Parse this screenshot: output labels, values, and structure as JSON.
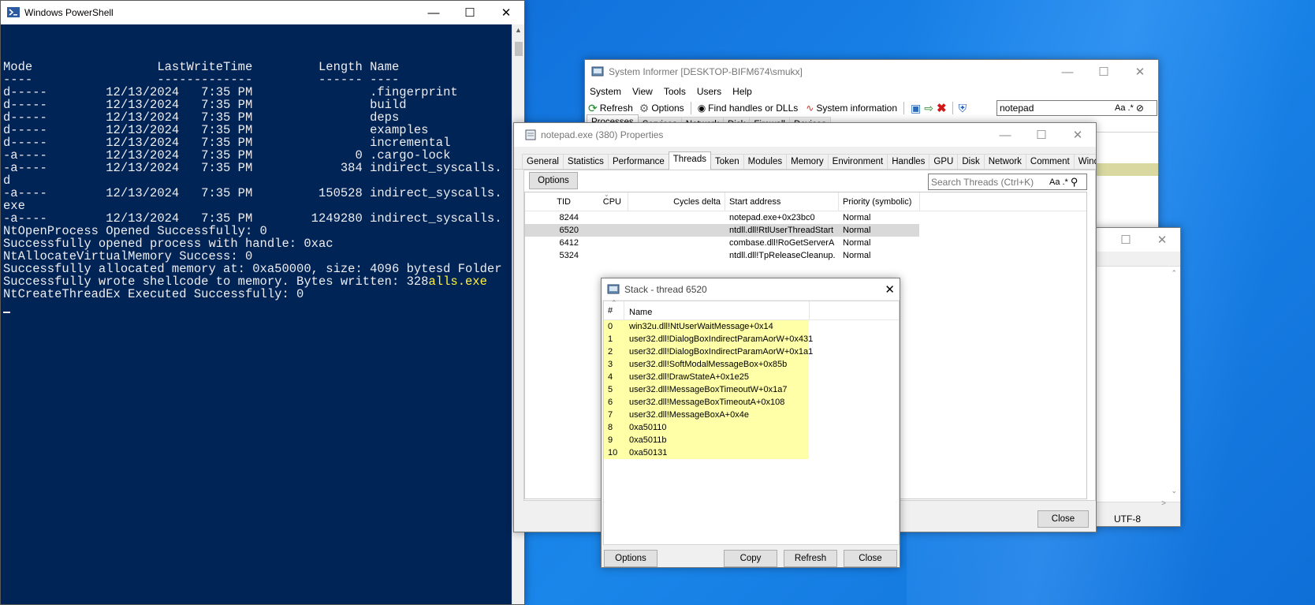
{
  "powershell": {
    "title": "Windows PowerShell",
    "lines": [
      "",
      "Mode                 LastWriteTime         Length Name",
      "----                 -------------         ------ ----",
      "d-----        12/13/2024   7:35 PM                .fingerprint",
      "d-----        12/13/2024   7:35 PM                build",
      "d-----        12/13/2024   7:35 PM                deps",
      "d-----        12/13/2024   7:35 PM                examples",
      "d-----        12/13/2024   7:35 PM                incremental",
      "-a----        12/13/2024   7:35 PM              0 .cargo-lock",
      "-a----        12/13/2024   7:35 PM            384 indirect_syscalls.",
      "d",
      "-a----        12/13/2024   7:35 PM         150528 indirect_syscalls.",
      "exe",
      "-a----        12/13/2024   7:35 PM        1249280 indirect_syscalls.",
      "NtOpenProcess Opened Successfully: 0",
      "Successfully opened process with handle: 0xac",
      "NtAllocateVirtualMemory Success: 0",
      "Successfully allocated memory at: 0xa50000, size: 4096 bytesd Folder",
      "Successfully wrote shellcode to memory. Bytes written: 328",
      "NtCreateThreadEx Executed Successfully: 0"
    ],
    "line_19_suffix": "alls.exe"
  },
  "system_informer": {
    "title": "System Informer [DESKTOP-BIFM674\\smukx]",
    "menu": [
      "System",
      "View",
      "Tools",
      "Users",
      "Help"
    ],
    "toolbar": {
      "refresh": "Refresh",
      "options": "Options",
      "find_handles": "Find handles or DLLs",
      "system_info": "System information",
      "search_value": "notepad"
    },
    "tabs": [
      "Processes",
      "Services",
      "Network",
      "Disk",
      "Firewall",
      "Devices"
    ]
  },
  "properties": {
    "title": "notepad.exe (380) Properties",
    "tabs": [
      "General",
      "Statistics",
      "Performance",
      "Threads",
      "Token",
      "Modules",
      "Memory",
      "Environment",
      "Handles",
      "GPU",
      "Disk",
      "Network",
      "Comment",
      "Windows"
    ],
    "options_label": "Options",
    "search_placeholder": "Search Threads (Ctrl+K)",
    "columns": [
      "TID",
      "CPU",
      "Cycles delta",
      "Start address",
      "Priority (symbolic)"
    ],
    "rows": [
      {
        "tid": "8244",
        "start": "notepad.exe+0x23bc0",
        "priority": "Normal"
      },
      {
        "tid": "6520",
        "start": "ntdll.dll!RtlUserThreadStart",
        "priority": "Normal"
      },
      {
        "tid": "6412",
        "start": "combase.dll!RoGetServerA...",
        "priority": "Normal"
      },
      {
        "tid": "5324",
        "start": "ntdll.dll!TpReleaseCleanup...",
        "priority": "Normal"
      }
    ],
    "close_label": "Close"
  },
  "behind_window": {
    "encoding": "UTF-8"
  },
  "stack": {
    "title": "Stack - thread 6520",
    "columns": [
      "#",
      "Name"
    ],
    "frames": [
      {
        "n": "0",
        "name": "win32u.dll!NtUserWaitMessage+0x14"
      },
      {
        "n": "1",
        "name": "user32.dll!DialogBoxIndirectParamAorW+0x431"
      },
      {
        "n": "2",
        "name": "user32.dll!DialogBoxIndirectParamAorW+0x1a1"
      },
      {
        "n": "3",
        "name": "user32.dll!SoftModalMessageBox+0x85b"
      },
      {
        "n": "4",
        "name": "user32.dll!DrawStateA+0x1e25"
      },
      {
        "n": "5",
        "name": "user32.dll!MessageBoxTimeoutW+0x1a7"
      },
      {
        "n": "6",
        "name": "user32.dll!MessageBoxTimeoutA+0x108"
      },
      {
        "n": "7",
        "name": "user32.dll!MessageBoxA+0x4e"
      },
      {
        "n": "8",
        "name": "0xa50110"
      },
      {
        "n": "9",
        "name": "0xa5011b"
      },
      {
        "n": "10",
        "name": "0xa50131"
      }
    ],
    "buttons": {
      "options": "Options",
      "copy": "Copy",
      "refresh": "Refresh",
      "close": "Close"
    }
  },
  "colors": {
    "ps_background": "#012456",
    "stack_highlight": "#ffffa8",
    "selected_row": "#d9d9d9"
  }
}
